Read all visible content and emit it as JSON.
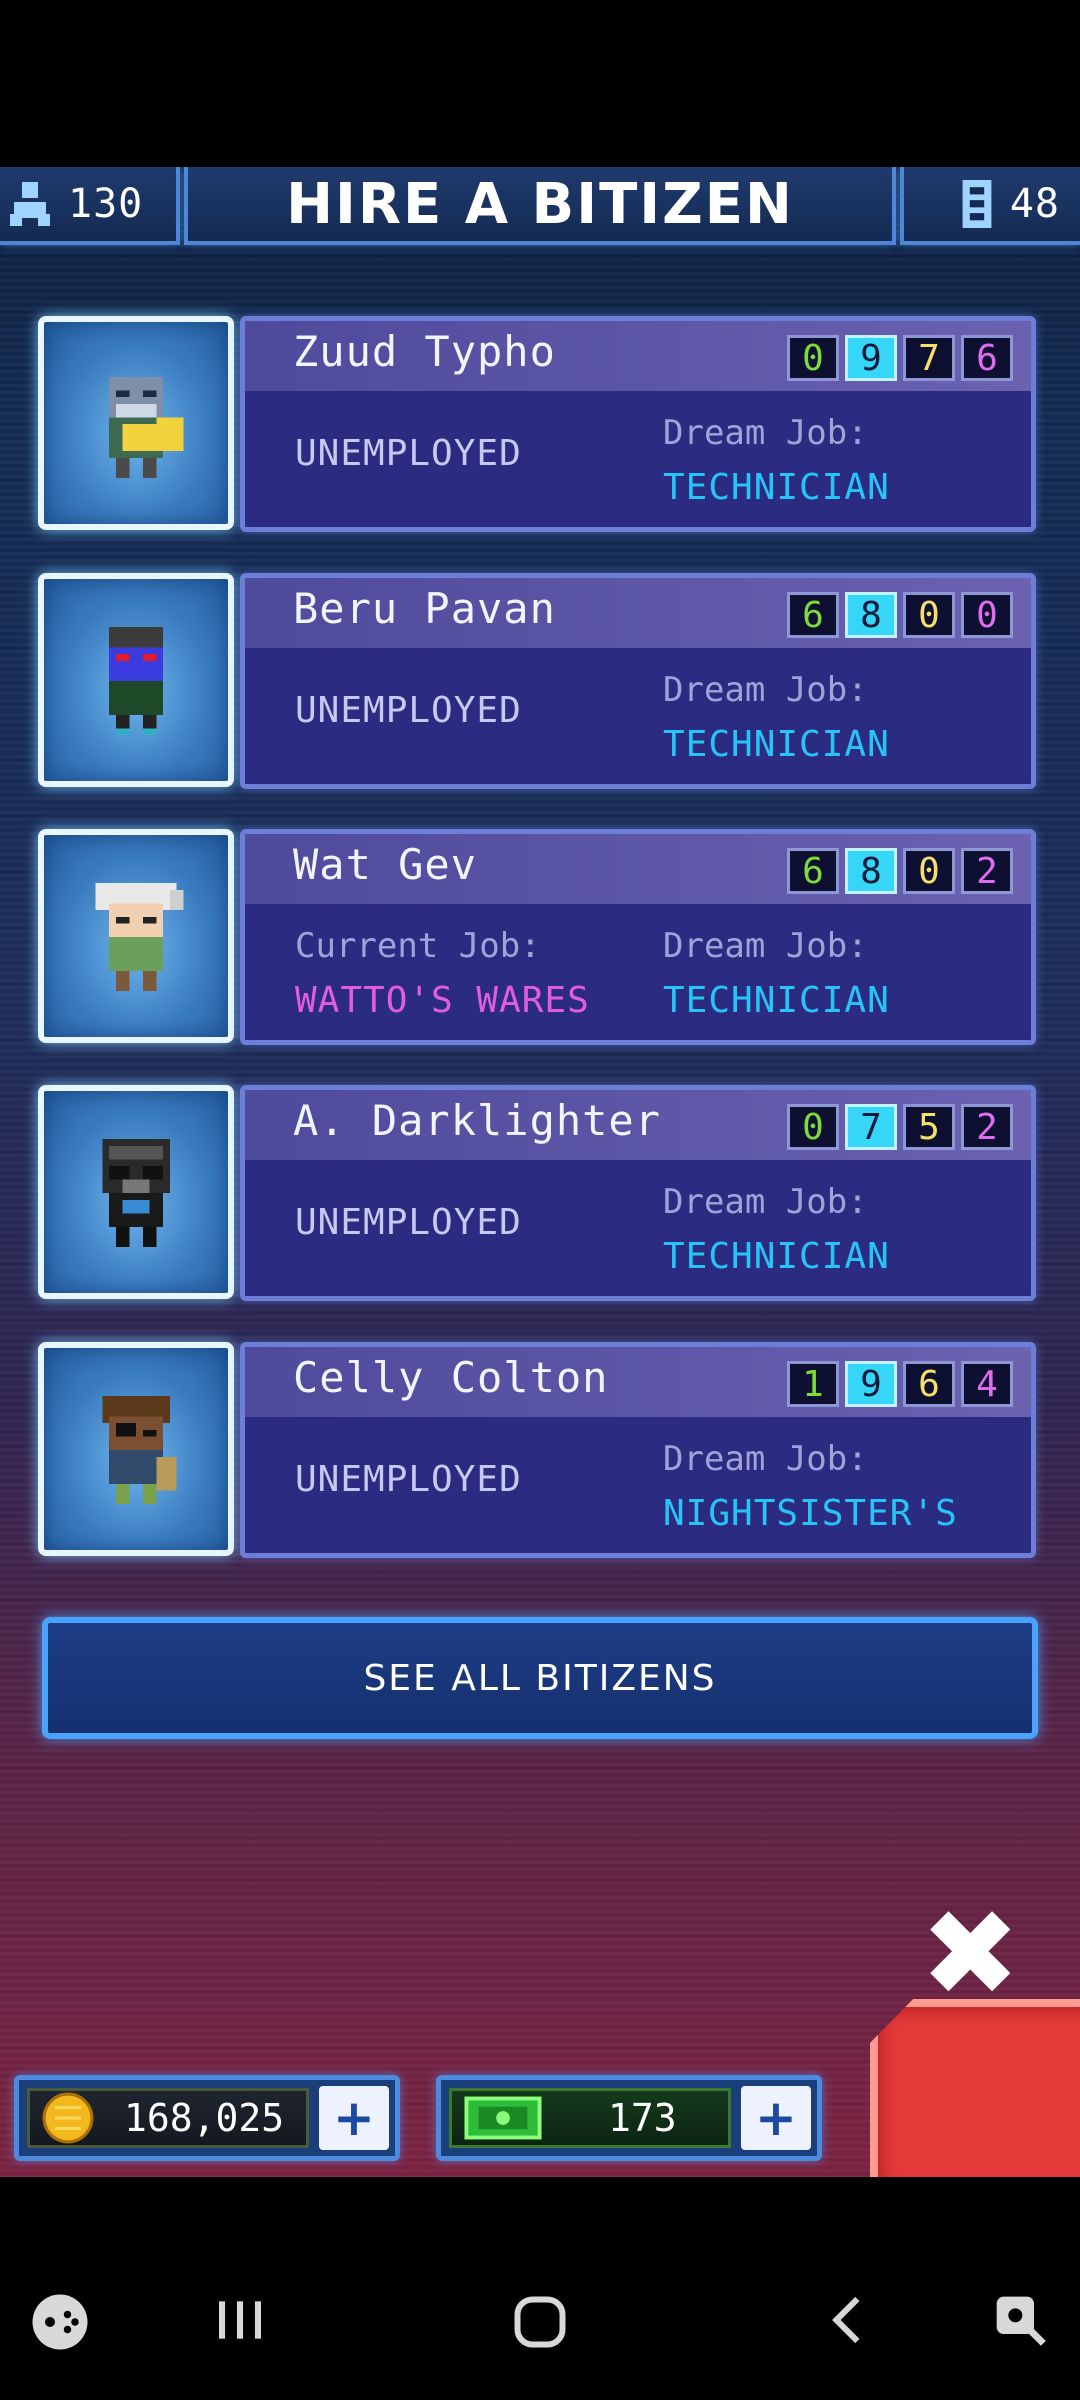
{
  "header": {
    "population": "130",
    "title": "HIRE A BITIZEN",
    "floors": "48"
  },
  "bitizens": [
    {
      "name": "Zuud Typho",
      "stats": [
        "0",
        "9",
        "7",
        "6"
      ],
      "highlight": 1,
      "status": "UNEMPLOYED",
      "current_job_label": "",
      "current_job": "",
      "dream_label": "Dream Job:",
      "dream_job": "TECHNICIAN",
      "avatar": "alien-helmet-avatar"
    },
    {
      "name": "Beru Pavan",
      "stats": [
        "6",
        "8",
        "0",
        "0"
      ],
      "highlight": 1,
      "status": "UNEMPLOYED",
      "current_job_label": "",
      "current_job": "",
      "dream_label": "Dream Job:",
      "dream_job": "TECHNICIAN",
      "avatar": "blue-alien-avatar"
    },
    {
      "name": "Wat Gev",
      "stats": [
        "6",
        "8",
        "0",
        "2"
      ],
      "highlight": 1,
      "status": "",
      "current_job_label": "Current Job:",
      "current_job": "WATTO'S WARES",
      "dream_label": "Dream Job:",
      "dream_job": "TECHNICIAN",
      "avatar": "white-hair-avatar"
    },
    {
      "name": "A. Darklighter",
      "stats": [
        "0",
        "7",
        "5",
        "2"
      ],
      "highlight": 1,
      "status": "UNEMPLOYED",
      "current_job_label": "",
      "current_job": "",
      "dream_label": "Dream Job:",
      "dream_job": "TECHNICIAN",
      "avatar": "tie-pilot-avatar"
    },
    {
      "name": "Celly Colton",
      "stats": [
        "1",
        "9",
        "6",
        "4"
      ],
      "highlight": 1,
      "status": "UNEMPLOYED",
      "current_job_label": "",
      "current_job": "",
      "dream_label": "Dream Job:",
      "dream_job": "NIGHTSISTER'S",
      "avatar": "eyepatch-avatar"
    }
  ],
  "stat_colors": [
    "#7ddc3a",
    "#35d6f7",
    "#f5e16a",
    "#e06cf0"
  ],
  "see_all_label": "SEE ALL BITIZENS",
  "coins": "168,025",
  "bux": "173",
  "colors": {
    "accent": "#4aa2ff",
    "dream_job": "#27c5f5",
    "current_job": "#e05de0",
    "close": "#e53a3a"
  }
}
